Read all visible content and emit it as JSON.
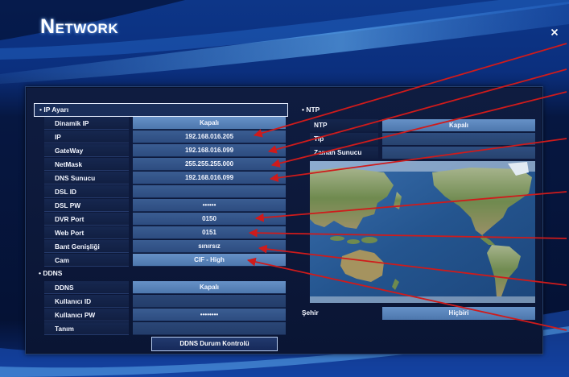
{
  "window": {
    "title": "NETWORK",
    "close_icon": "close-icon"
  },
  "ip_settings": {
    "header": "• IP Ayarı",
    "rows": [
      {
        "label": "Dinamik IP",
        "value": "Kapalı"
      },
      {
        "label": "IP",
        "value": "192.168.016.205"
      },
      {
        "label": "GateWay",
        "value": "192.168.016.099"
      },
      {
        "label": "NetMask",
        "value": "255.255.255.000"
      },
      {
        "label": "DNS Sunucu",
        "value": "192.168.016.099"
      },
      {
        "label": "DSL ID",
        "value": ""
      },
      {
        "label": "DSL PW",
        "value": "••••••"
      },
      {
        "label": "DVR Port",
        "value": "0150"
      },
      {
        "label": "Web Port",
        "value": "0151"
      },
      {
        "label": "Bant Genişliği",
        "value": "sınırsız"
      },
      {
        "label": "Cam",
        "value": "CIF - High"
      }
    ]
  },
  "ddns": {
    "header": "• DDNS",
    "rows": [
      {
        "label": "DDNS",
        "value": "Kapalı"
      },
      {
        "label": "Kullanıcı ID",
        "value": ""
      },
      {
        "label": "Kullanıcı PW",
        "value": "••••••••"
      },
      {
        "label": "Tanım",
        "value": ""
      }
    ],
    "check_button": "DDNS Durum Kontrolü"
  },
  "ntp": {
    "header": "• NTP",
    "rows": [
      {
        "label": "NTP",
        "value": "Kapalı"
      },
      {
        "label": "Tip",
        "value": ""
      },
      {
        "label": "Zaman Sunucu",
        "value": ""
      }
    ],
    "map_icon": "world-map",
    "city": {
      "label": "Şehir",
      "value": "Hiçbiri"
    }
  },
  "colors": {
    "annotation": "#cf1b1b",
    "selected_value": "#5a84ba",
    "field_value": "#34568a",
    "focus_border": "#e6eeff"
  }
}
